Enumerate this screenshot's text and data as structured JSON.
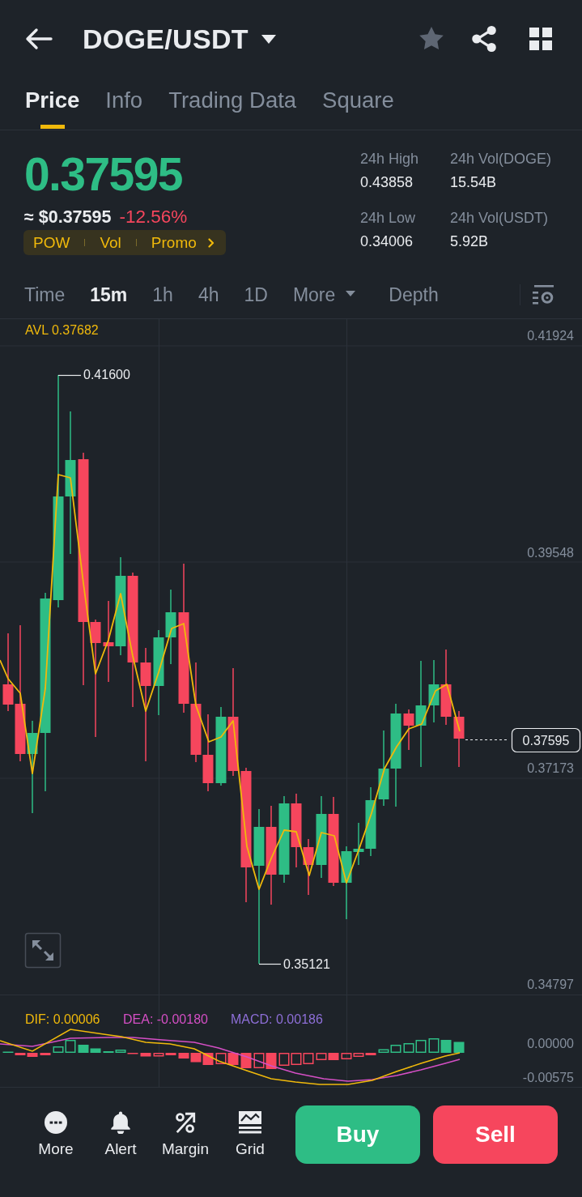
{
  "header": {
    "title": "DOGE/USDT",
    "favorite": false
  },
  "tabs": [
    {
      "label": "Price",
      "selected": true
    },
    {
      "label": "Info",
      "selected": false
    },
    {
      "label": "Trading Data",
      "selected": false
    },
    {
      "label": "Square",
      "selected": false
    }
  ],
  "ticker": {
    "price": "0.37595",
    "price_rising": true,
    "fiat_price": "≈ $0.37595",
    "change": "-12.56%",
    "change_rising": false,
    "tags": [
      "POW",
      "Vol",
      "Promo"
    ]
  },
  "stats": [
    {
      "label": "24h High",
      "value": "0.43858"
    },
    {
      "label": "24h Vol(DOGE)",
      "value": "15.54B"
    },
    {
      "label": "24h Low",
      "value": "0.34006"
    },
    {
      "label": "24h Vol(USDT)",
      "value": "5.92B"
    }
  ],
  "intervals": [
    {
      "label": "Time",
      "selected": false,
      "kind": "option"
    },
    {
      "label": "15m",
      "selected": true,
      "kind": "option"
    },
    {
      "label": "1h",
      "selected": false,
      "kind": "option"
    },
    {
      "label": "4h",
      "selected": false,
      "kind": "option"
    },
    {
      "label": "1D",
      "selected": false,
      "kind": "option"
    },
    {
      "label": "More",
      "selected": false,
      "kind": "menu"
    },
    {
      "label": "Depth",
      "selected": false,
      "kind": "option"
    }
  ],
  "chart": {
    "average": "AVL 0.37682",
    "price_axis": [
      "0.41924",
      "0.39548",
      "0.37173",
      "0.34797"
    ],
    "high_marker": "0.41600",
    "low_marker": "0.35121",
    "last_price": "0.37595"
  },
  "macd": {
    "dif": "DIF: 0.00006",
    "dea": "DEA: -0.00180",
    "macd": "MACD: 0.00186",
    "axis": [
      "0.00000",
      "-0.00575"
    ]
  },
  "bottom_bar": {
    "actions": [
      {
        "label": "More",
        "kind": "more"
      },
      {
        "label": "Alert",
        "kind": "alert"
      },
      {
        "label": "Margin",
        "kind": "margin"
      },
      {
        "label": "Grid",
        "kind": "grid"
      }
    ],
    "buy": "Buy",
    "sell": "Sell"
  }
}
